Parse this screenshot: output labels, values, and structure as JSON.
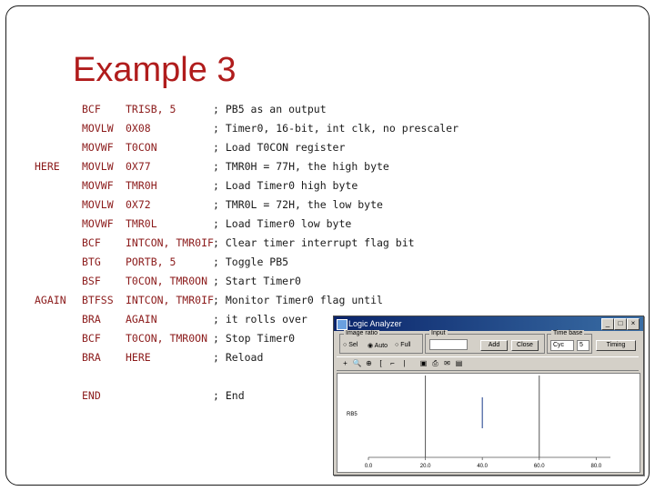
{
  "slide": {
    "title": "Example 3"
  },
  "code": [
    {
      "label": "",
      "op": "BCF",
      "arg": "TRISB, 5",
      "comment": "; PB5 as an output"
    },
    {
      "label": "",
      "op": "MOVLW",
      "arg": "0X08",
      "comment": "; Timer0, 16-bit, int clk, no prescaler"
    },
    {
      "label": "",
      "op": "MOVWF",
      "arg": "T0CON",
      "comment": "; Load T0CON register"
    },
    {
      "label": "HERE",
      "op": "MOVLW",
      "arg": "0X77",
      "comment": "; TMR0H = 77H, the high byte"
    },
    {
      "label": "",
      "op": "MOVWF",
      "arg": "TMR0H",
      "comment": "; Load Timer0 high byte"
    },
    {
      "label": "",
      "op": "MOVLW",
      "arg": "0X72",
      "comment": "; TMR0L = 72H, the low byte"
    },
    {
      "label": "",
      "op": "MOVWF",
      "arg": "TMR0L",
      "comment": "; Load Timer0 low byte"
    },
    {
      "label": "",
      "op": "BCF",
      "arg": "INTCON, TMR0IF",
      "comment": "; Clear timer interrupt flag bit"
    },
    {
      "label": "",
      "op": "BTG",
      "arg": "PORTB, 5",
      "comment": "; Toggle PB5"
    },
    {
      "label": "",
      "op": "BSF",
      "arg": "T0CON, TMR0ON",
      "comment": "; Start Timer0"
    },
    {
      "label": "AGAIN",
      "op": "BTFSS",
      "arg": "INTCON, TMR0IF",
      "comment": "; Monitor Timer0 flag until"
    },
    {
      "label": "",
      "op": "BRA",
      "arg": "AGAIN",
      "comment": "; it rolls over"
    },
    {
      "label": "",
      "op": "BCF",
      "arg": "T0CON, TMR0ON",
      "comment": "; Stop Timer0"
    },
    {
      "label": "",
      "op": "BRA",
      "arg": "HERE",
      "comment": "; Reload"
    },
    {
      "label": "",
      "op": "",
      "arg": "",
      "comment": ""
    },
    {
      "label": "",
      "op": "END",
      "arg": "",
      "comment": "; End"
    }
  ],
  "analyzer": {
    "title": "Logic Analyzer",
    "buttons": {
      "minimize": "_",
      "maximize": "□",
      "close": "×"
    },
    "options": {
      "range_group": "Image ratio",
      "radio_a": "Sel",
      "radio_b": "Auto",
      "radio_c": "Full",
      "input_group": "Input",
      "add_button": "Add",
      "close_button": "Close",
      "time_base_group": "Time base",
      "time_base_value": "Cyc",
      "time_unit": "5",
      "timing_button": "Timing"
    },
    "toolbar_icons": [
      "+",
      "🔍",
      "⊕",
      "[",
      "⌐",
      "|",
      "▣",
      "⎙",
      "✉",
      "▤"
    ],
    "plot": {
      "signal_label": "RB5",
      "x_ticks": [
        "0.0",
        "20.0",
        "40.0",
        "60.0",
        "80.0"
      ],
      "x_domain": [
        0,
        85
      ]
    }
  }
}
